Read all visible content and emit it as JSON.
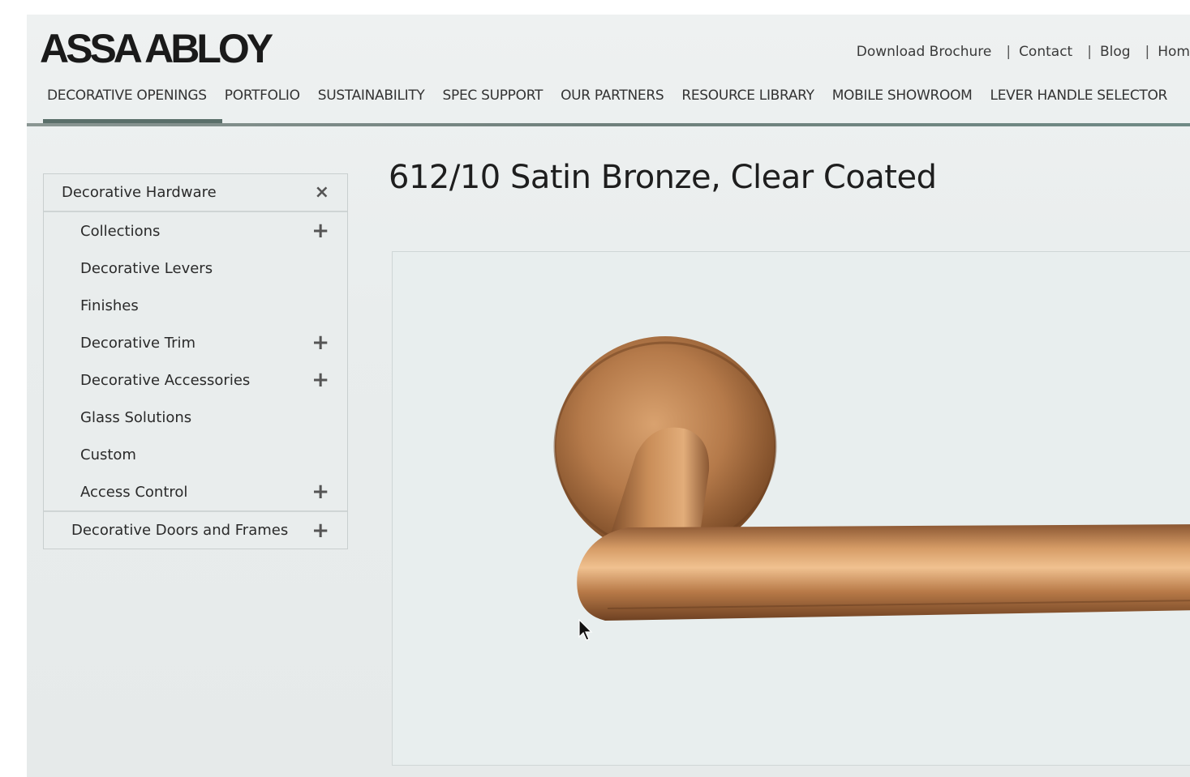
{
  "brand": {
    "logo_text": "ASSA ABLOY"
  },
  "utility_nav": {
    "links": [
      "Download Brochure",
      "Contact",
      "Blog",
      "Hom"
    ],
    "separator": "|"
  },
  "main_nav": {
    "items": [
      "DECORATIVE OPENINGS",
      "PORTFOLIO",
      "SUSTAINABILITY",
      "SPEC SUPPORT",
      "OUR PARTNERS",
      "RESOURCE LIBRARY",
      "MOBILE SHOWROOM",
      "LEVER HANDLE SELECTOR"
    ],
    "active_index": 0
  },
  "sidebar": {
    "header": {
      "label": "Decorative Hardware",
      "icon": "close-icon",
      "icon_glyph": "×"
    },
    "items": [
      {
        "label": "Collections",
        "icon": "plus-icon",
        "icon_glyph": "+"
      },
      {
        "label": "Decorative Levers",
        "icon": "",
        "icon_glyph": ""
      },
      {
        "label": "Finishes",
        "icon": "",
        "icon_glyph": ""
      },
      {
        "label": "Decorative Trim",
        "icon": "plus-icon",
        "icon_glyph": "+"
      },
      {
        "label": "Decorative Accessories",
        "icon": "plus-icon",
        "icon_glyph": "+"
      },
      {
        "label": "Glass Solutions",
        "icon": "",
        "icon_glyph": ""
      },
      {
        "label": "Custom",
        "icon": "",
        "icon_glyph": ""
      },
      {
        "label": "Access Control",
        "icon": "plus-icon",
        "icon_glyph": "+"
      }
    ],
    "footer": {
      "label": "Decorative Doors and Frames",
      "icon": "plus-icon",
      "icon_glyph": "+"
    }
  },
  "product": {
    "title": "612/10 Satin Bronze, Clear Coated",
    "image": "satin-bronze-lever-handle",
    "finish_color": "#b57a4a"
  },
  "colors": {
    "nav_accent": "#5a6f6a",
    "background": "#e9eded"
  }
}
